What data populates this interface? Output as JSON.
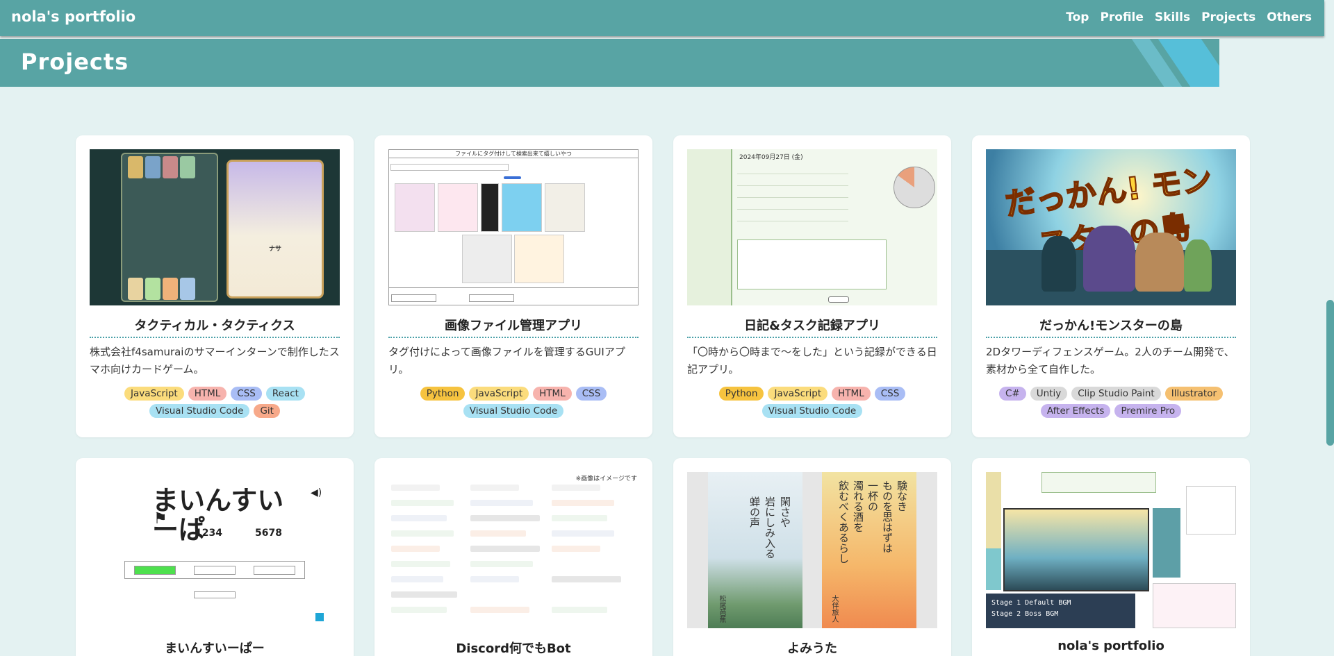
{
  "header": {
    "brand": "nola's portfolio",
    "nav": [
      "Top",
      "Profile",
      "Skills",
      "Projects",
      "Others"
    ]
  },
  "section": {
    "title": "Projects"
  },
  "colors": {
    "teal": "#58a4a4",
    "tag_yellow": "#fbdc7c",
    "tag_pink": "#f7b3ad",
    "tag_blue": "#a9bdf5",
    "tag_cyan": "#a8e1f3",
    "tag_orange": "#f7a98a",
    "tag_purple": "#c6b3ee",
    "tag_gray": "#d9d9d9",
    "tag_amber": "#f5c071",
    "tag_gold": "#f6c33f"
  },
  "projects": [
    {
      "title": "タクティカル・タクティクス",
      "desc": "株式会社f4samuraiのサマーインターンで制作したスマホ向けカードゲーム。",
      "tags": [
        "JavaScript",
        "HTML",
        "CSS",
        "React",
        "Visual Studio Code",
        "Git"
      ],
      "thumb_text": "ナサ"
    },
    {
      "title": "画像ファイル管理アプリ",
      "desc": "タグ付けによって画像ファイルを管理するGUIアプリ。",
      "tags": [
        "Python",
        "JavaScript",
        "HTML",
        "CSS",
        "Visual Studio Code"
      ],
      "thumb_text": "ファイルにタグ付けして検索出来て嬉しいやつ"
    },
    {
      "title": "日記&タスク記録アプリ",
      "desc": "「〇時から〇時まで〜をした」という記録ができる日記アプリ。",
      "tags": [
        "Python",
        "JavaScript",
        "HTML",
        "CSS",
        "Visual Studio Code"
      ],
      "thumb_text": "2024年09月27日 (金)"
    },
    {
      "title": "だっかん!モンスターの島",
      "desc": "2Dタワーディフェンスゲーム。2人のチーム開発で、素材から全て自作した。",
      "tags": [
        "C#",
        "Untiy",
        "Clip Studio Paint",
        "Illustrator",
        "After Effects",
        "Premire Pro"
      ],
      "thumb_text": "だっかん! モンスターの島"
    },
    {
      "title": "まいんすいーぱー",
      "thumb_title": "まいんすいーぱ",
      "thumb_nums": [
        "1234",
        "5678"
      ]
    },
    {
      "title": "Discord何でもBot",
      "thumb_note": "※画像はイメージです"
    },
    {
      "title": "よみうた",
      "poem1": [
        "閑さや",
        "岩にしみ入る",
        "蝉の声"
      ],
      "poet1": "松尾芭蕉",
      "poem2": [
        "験なき",
        "ものを思はずは",
        "一杯の",
        "濁れる酒を",
        "飲むべくあるらし"
      ],
      "poet2": "大伴旅人"
    },
    {
      "title": "nola's portfolio",
      "stage_lines": [
        "Stage 1  Default BGM",
        "Stage 2  Boss BGM"
      ]
    }
  ]
}
